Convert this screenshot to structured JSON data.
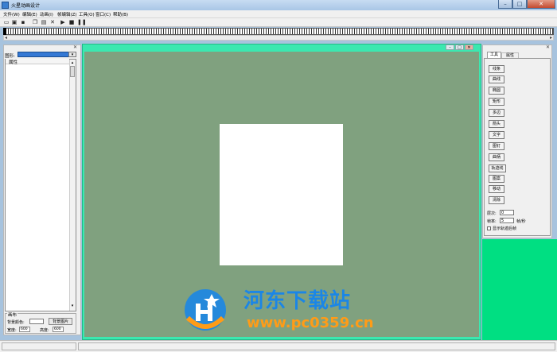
{
  "window": {
    "title": "火星动画设计",
    "minimize": "–",
    "maximize": "□",
    "close": "✕"
  },
  "menu": [
    "文件(W)",
    "编辑(E)",
    "动画(I)",
    "帧编辑(Z)",
    "工具(O)",
    "窗口(C)",
    "帮助(B)"
  ],
  "toolbar_icons": [
    "open-icon",
    "save-all-icon",
    "save-icon",
    "copy-icon",
    "paste-icon",
    "delete-icon",
    "play-icon",
    "stop-icon",
    "pause-icon"
  ],
  "left_panel": {
    "shape_label": "图形:",
    "props_header": "属性",
    "canvas_group": "画布",
    "bgcolor_label": "背景颜色:",
    "bgimage_button": "背景图片",
    "width_label": "宽度:",
    "width_value": "600",
    "height_label": "高度:",
    "height_value": "600"
  },
  "right_panel": {
    "tabs": [
      "工具",
      "属性"
    ],
    "tools": [
      "线条",
      "曲线",
      "椭圆",
      "矩形",
      "多边",
      "箭头",
      "文字",
      "图钉",
      "曲柄",
      "轨迹线",
      "图案",
      "移动",
      "清除"
    ],
    "layer_label": "层次:",
    "layer_value": "0",
    "fps_label": "帧率:",
    "fps_value": "5",
    "fps_unit": "帧/秒",
    "show_guides": "显示轨迹后帧"
  },
  "watermark": {
    "title": "河东下载站",
    "url": "www.pc0359.cn"
  },
  "colors": {
    "canvas_bg": "#80a17f",
    "canvas_frame": "#3be8b0",
    "right_green": "#00df82",
    "watermark_blue": "#1b86e6",
    "watermark_orange": "#ff9c17"
  }
}
